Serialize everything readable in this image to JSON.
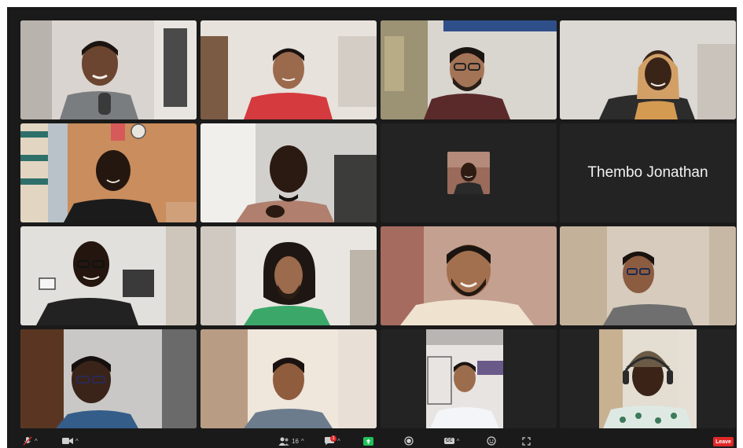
{
  "meeting": {
    "participants": [
      {
        "id": 1,
        "label": "participant-video"
      },
      {
        "id": 2,
        "label": "participant-video"
      },
      {
        "id": 3,
        "label": "participant-video"
      },
      {
        "id": 4,
        "label": "participant-video"
      },
      {
        "id": 5,
        "label": "participant-video"
      },
      {
        "id": 6,
        "label": "participant-video"
      },
      {
        "id": 7,
        "label": "participant-avatar"
      },
      {
        "id": 8,
        "name": "Thembo Jonathan"
      },
      {
        "id": 9,
        "label": "participant-video"
      },
      {
        "id": 10,
        "label": "participant-video"
      },
      {
        "id": 11,
        "label": "participant-video"
      },
      {
        "id": 12,
        "label": "participant-video"
      },
      {
        "id": 13,
        "label": "participant-video"
      },
      {
        "id": 14,
        "label": "participant-video"
      },
      {
        "id": 15,
        "label": "participant-video"
      },
      {
        "id": 16,
        "label": "participant-video"
      }
    ]
  },
  "toolbar": {
    "participants_count": "16",
    "chat_badge": "1",
    "leave_label": "Leave",
    "icons": [
      "microphone-muted-icon",
      "video-camera-icon",
      "participants-icon",
      "chat-icon",
      "share-screen-icon",
      "record-icon",
      "captions-icon",
      "reactions-icon",
      "fullscreen-icon"
    ],
    "captions_label": "CC"
  },
  "colors": {
    "window_bg": "#1a1a1a",
    "tile_bg": "#232323",
    "active_speaker": "#7ecb52",
    "leave": "#e02828",
    "share_green": "#21c15b"
  }
}
